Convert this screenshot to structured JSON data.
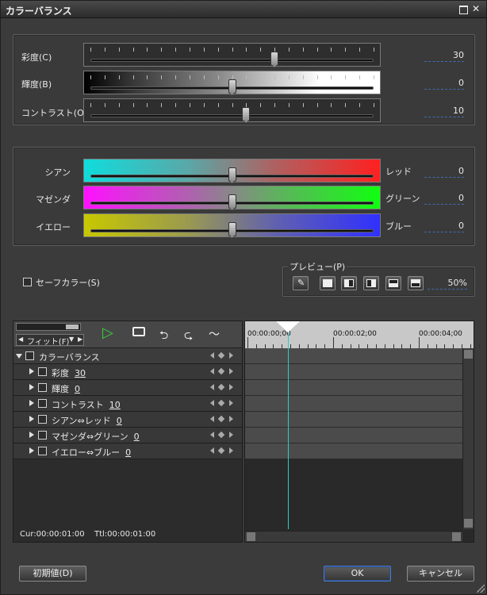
{
  "window": {
    "title": "カラーバランス"
  },
  "basic": {
    "items": [
      {
        "label": "彩度(C)",
        "value": "30",
        "pos": 0.65
      },
      {
        "label": "輝度(B)",
        "value": "0",
        "pos": 0.5
      },
      {
        "label": "コントラスト(O)",
        "value": "10",
        "pos": 0.55
      }
    ]
  },
  "balance": {
    "items": [
      {
        "left": "シアン",
        "right": "レッド",
        "value": "0",
        "pos": 0.5
      },
      {
        "left": "マゼンダ",
        "right": "グリーン",
        "value": "0",
        "pos": 0.5
      },
      {
        "left": "イエロー",
        "right": "ブルー",
        "value": "0",
        "pos": 0.5
      }
    ]
  },
  "safe_color": {
    "label": "セーフカラー(S)"
  },
  "preview": {
    "label": "プレビュー(P)",
    "zoom": "50%"
  },
  "timeline": {
    "fit_label": "フィット(F)",
    "ruler": [
      "00:00:00;00",
      "00:00:02;00",
      "00:00:04;00"
    ],
    "tree": [
      {
        "label": "カラーバランス",
        "value": ""
      },
      {
        "label": "彩度",
        "value": "30"
      },
      {
        "label": "輝度",
        "value": "0"
      },
      {
        "label": "コントラスト",
        "value": "10"
      },
      {
        "label": "シアン⇔レッド",
        "value": "0"
      },
      {
        "label": "マゼンダ⇔グリーン",
        "value": "0"
      },
      {
        "label": "イエロー⇔ブルー",
        "value": "0"
      }
    ],
    "cur": "Cur:00:00:01:00",
    "ttl": "Ttl:00:00:01:00"
  },
  "footer": {
    "reset": "初期値(D)",
    "ok": "OK",
    "cancel": "キャンセル"
  },
  "colors": {
    "accent": "#4a78c8",
    "cursor": "#38c8c8"
  }
}
